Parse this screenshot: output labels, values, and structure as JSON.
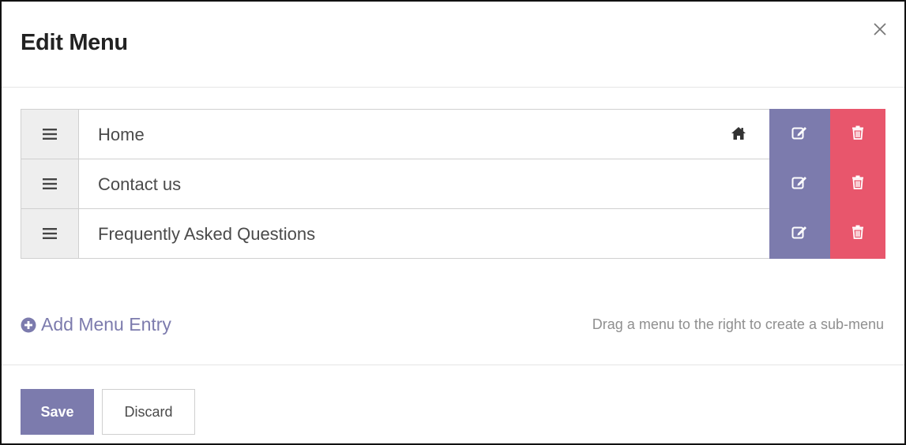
{
  "dialog": {
    "title": "Edit Menu",
    "close_icon": "close-icon"
  },
  "menu_entries": [
    {
      "label": "Home",
      "is_home": true
    },
    {
      "label": "Contact us",
      "is_home": false
    },
    {
      "label": "Frequently Asked Questions",
      "is_home": false
    }
  ],
  "actions": {
    "add_entry_label": "Add Menu Entry",
    "hint": "Drag a menu to the right to create a sub-menu"
  },
  "footer": {
    "save_label": "Save",
    "discard_label": "Discard"
  },
  "colors": {
    "primary": "#7c7bad",
    "danger": "#e8566c",
    "handle_bg": "#eeeeee"
  }
}
